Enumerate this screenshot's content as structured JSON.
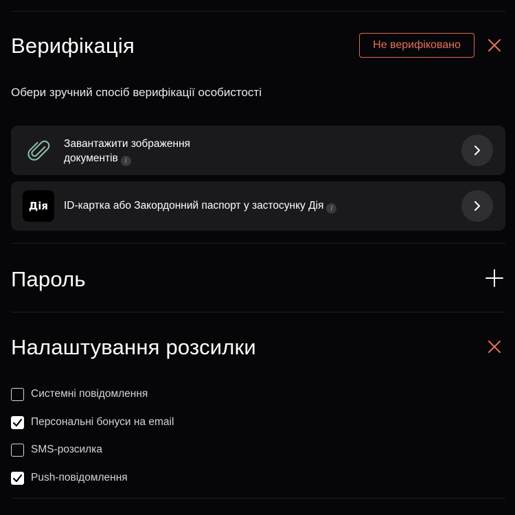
{
  "verification": {
    "title": "Верифікація",
    "status": "Не верифіковано",
    "subtitle": "Обери зручний спосіб верифікації особистості",
    "close_icon": "close-icon",
    "options": [
      {
        "icon": "paperclip-icon",
        "line1": "Завантажити зображення",
        "line2": "документів",
        "info_icon": "i"
      },
      {
        "icon": "diia-logo",
        "logo_text": "Дія",
        "label": "ID-картка або Закордонний паспорт у застосунку Дія",
        "info_icon": "i"
      }
    ]
  },
  "password": {
    "title": "Пароль",
    "expand_icon": "plus-icon"
  },
  "mailing": {
    "title": "Налаштування розсилки",
    "close_icon": "close-icon",
    "items": [
      {
        "label": "Системні повідомлення",
        "checked": false
      },
      {
        "label": "Персональні бонуси на email",
        "checked": true
      },
      {
        "label": "SMS-розсилка",
        "checked": false
      },
      {
        "label": "Push-повідомлення",
        "checked": true
      }
    ]
  },
  "colors": {
    "background": "#060608",
    "accent": "#e8705a",
    "card": "#1a1a1d"
  }
}
